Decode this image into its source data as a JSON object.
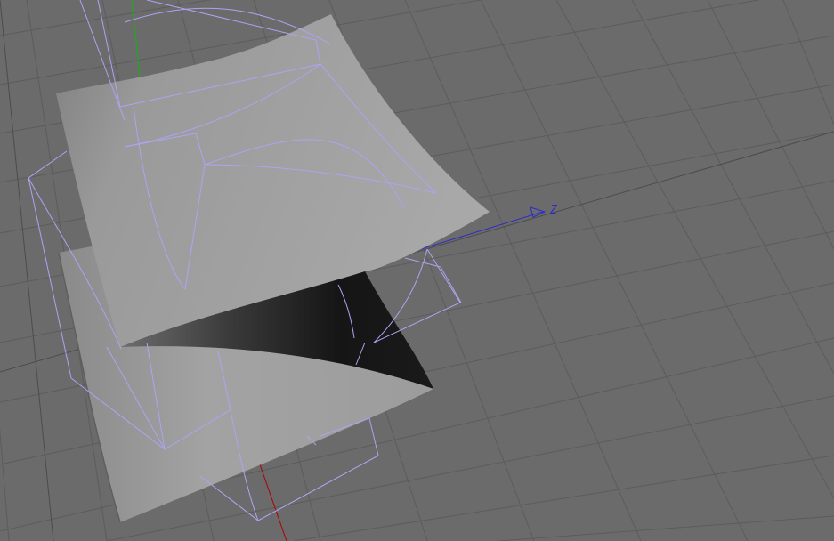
{
  "viewport": {
    "background": "#6b6b6b",
    "grid_color": "#5a5a5a",
    "wire_color": "#a9a2f0",
    "surface_light": "#a2a2a2",
    "surface_dark": "#141414",
    "axis_colors": {
      "x": "#b00000",
      "y": "#00b000",
      "z": "#2d2dc8"
    },
    "axis_label_z": "Z"
  },
  "scene": {
    "objects": [
      {
        "name": "upper-surface",
        "type": "curved-plane",
        "shading": "gradient-gray"
      },
      {
        "name": "lower-surface",
        "type": "curved-plane",
        "shading": "gradient-gray"
      },
      {
        "name": "backface",
        "type": "surface-underside",
        "shading": "black"
      },
      {
        "name": "bounding-wireframe",
        "type": "deformer-cage",
        "display": "wireframe"
      }
    ]
  }
}
